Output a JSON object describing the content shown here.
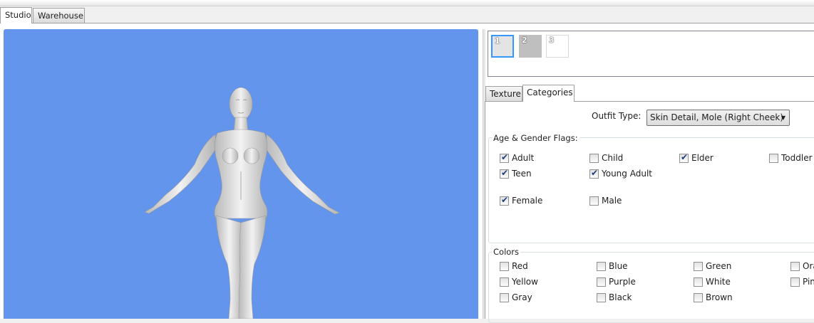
{
  "main_tabs": [
    "Studio",
    "Warehouse"
  ],
  "thumbnails": [
    "1",
    "2",
    "3"
  ],
  "inner_tabs": [
    "Texture",
    "Categories"
  ],
  "outfit": {
    "label": "Outfit Type:",
    "value": "Skin Detail, Mole (Right Cheek)"
  },
  "age_gender": {
    "title": "Age & Gender Flags:",
    "adult": {
      "label": "Adult",
      "checked": true
    },
    "child": {
      "label": "Child",
      "checked": false
    },
    "elder": {
      "label": "Elder",
      "checked": true
    },
    "toddler": {
      "label": "Toddler",
      "checked": false
    },
    "teen": {
      "label": "Teen",
      "checked": true
    },
    "young_adult": {
      "label": "Young Adult",
      "checked": true
    },
    "female": {
      "label": "Female",
      "checked": true
    },
    "male": {
      "label": "Male",
      "checked": false
    }
  },
  "colors": {
    "title": "Colors",
    "red": "Red",
    "blue": "Blue",
    "green": "Green",
    "orange": "Ora",
    "yellow": "Yellow",
    "purple": "Purple",
    "white": "White",
    "pink": "Pin",
    "gray": "Gray",
    "black": "Black",
    "brown": "Brown"
  },
  "viewport_color": "#6495ED",
  "check_glyph": "✔"
}
